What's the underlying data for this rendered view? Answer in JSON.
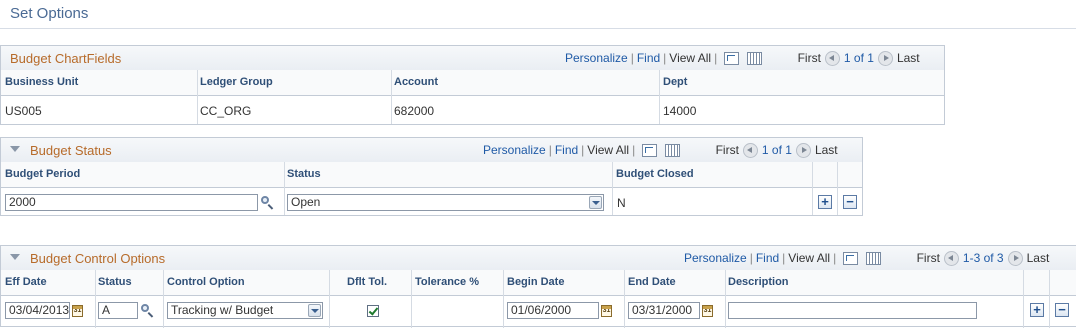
{
  "page": {
    "title": "Set Options"
  },
  "chartfields": {
    "title": "Budget ChartFields",
    "nav": {
      "personalize": "Personalize",
      "find": "Find",
      "view_all": "View All",
      "first": "First",
      "range": "1 of 1",
      "last": "Last"
    },
    "columns": [
      "Business Unit",
      "Ledger Group",
      "Account",
      "Dept"
    ],
    "row": [
      "US005",
      "CC_ORG",
      "682000",
      "14000"
    ]
  },
  "status": {
    "title": "Budget Status",
    "nav": {
      "personalize": "Personalize",
      "find": "Find",
      "view_all": "View All",
      "first": "First",
      "range": "1 of 1",
      "last": "Last"
    },
    "columns": [
      "Budget Period",
      "Status",
      "Budget Closed"
    ],
    "row": {
      "budget_period": "2000",
      "status": "Open",
      "budget_closed": "N"
    },
    "add": "+",
    "remove": "−"
  },
  "control": {
    "title": "Budget Control Options",
    "nav": {
      "personalize": "Personalize",
      "find": "Find",
      "view_all": "View All",
      "first": "First",
      "range": "1-3 of 3",
      "last": "Last"
    },
    "columns": [
      "Eff Date",
      "Status",
      "Control Option",
      "Dflt Tol.",
      "Tolerance %",
      "Begin Date",
      "End Date",
      "Description"
    ],
    "row": {
      "eff_date": "03/04/2013",
      "status": "A",
      "control_option": "Tracking w/ Budget",
      "dflt_tol": true,
      "tolerance": "",
      "begin_date": "01/06/2000",
      "end_date": "03/31/2000",
      "description": ""
    },
    "add": "+",
    "remove": "−"
  },
  "icons": {
    "lookup": "magnifier-icon",
    "calendar": "calendar-icon",
    "download": "download-icon",
    "grid": "grid-icon"
  },
  "calendar_glyph": "31"
}
